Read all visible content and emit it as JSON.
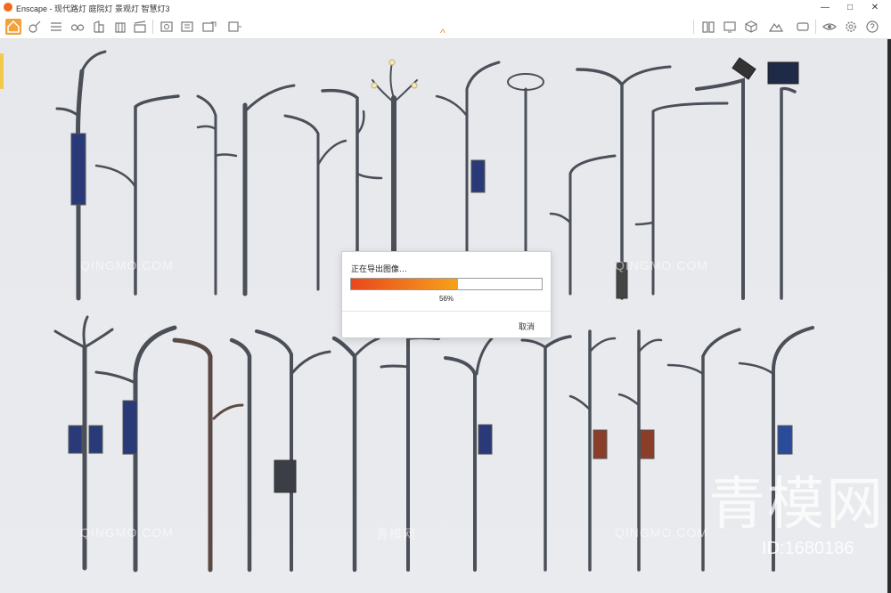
{
  "window": {
    "app_name": "Enscape",
    "title": "Enscape - 现代路灯 庭院灯 景观灯 智慧灯3",
    "controls": [
      "minimize",
      "maximize",
      "close"
    ]
  },
  "toolbar": {
    "icons": [
      "home-icon",
      "asset-icon",
      "list-icon",
      "glasses-icon",
      "building-icon",
      "clapper-icon",
      "screenshot-icon",
      "batch-render-icon",
      "export-icon",
      "web-export-icon",
      "book-icon",
      "monitor-icon",
      "cube-icon",
      "mountain-icon",
      "settings-panel-icon",
      "eye-icon",
      "gear-icon",
      "help-icon"
    ],
    "collapse_glyph": "^"
  },
  "dialog": {
    "title": "正在导出图像…",
    "progress": 0.56,
    "percent_label": "56%",
    "cancel_label": "取消",
    "bar_colors": [
      "#e8481c",
      "#f7a21b"
    ]
  },
  "watermarks": {
    "brand_cn": "青模网",
    "brand_en": "QINGMO.COM",
    "id_label": "ID:1680186"
  },
  "colors": {
    "accent": "#f26b1d",
    "home_button": "#f3a23a"
  }
}
